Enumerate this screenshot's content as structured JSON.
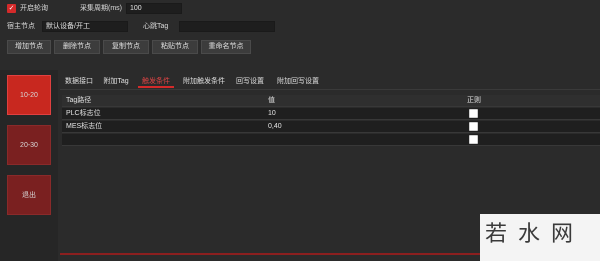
{
  "toolbar": {
    "enable_label": "开启轮询",
    "interval_label": "采集周期(ms)",
    "interval_value": "100",
    "parent_label": "宿主节点",
    "parent_value": "默认设备/开工",
    "heartbeat_label": "心跳Tag",
    "heartbeat_value": ""
  },
  "actions": {
    "add": "增加节点",
    "delete": "删除节点",
    "copy": "复制节点",
    "paste": "粘贴节点",
    "rename": "重命名节点"
  },
  "sidebar": {
    "items": [
      {
        "label": "10-20"
      },
      {
        "label": "20-30"
      },
      {
        "label": "退出"
      }
    ]
  },
  "tabs": [
    {
      "label": "数据接口"
    },
    {
      "label": "附加Tag"
    },
    {
      "label": "触发条件"
    },
    {
      "label": "附加触发条件"
    },
    {
      "label": "回写设置"
    },
    {
      "label": "附加回写设置"
    }
  ],
  "table": {
    "headers": [
      "Tag路径",
      "值",
      "正则"
    ],
    "rows": [
      {
        "tag": "PLC标志位",
        "value": "10",
        "regex": false
      },
      {
        "tag": "MES标志位",
        "value": "0,40",
        "regex": false
      },
      {
        "tag": "",
        "value": "",
        "regex": false
      }
    ]
  },
  "watermark": "若 水 网",
  "colors": {
    "accent": "#d42a2a",
    "background": "#2b2b2b"
  }
}
